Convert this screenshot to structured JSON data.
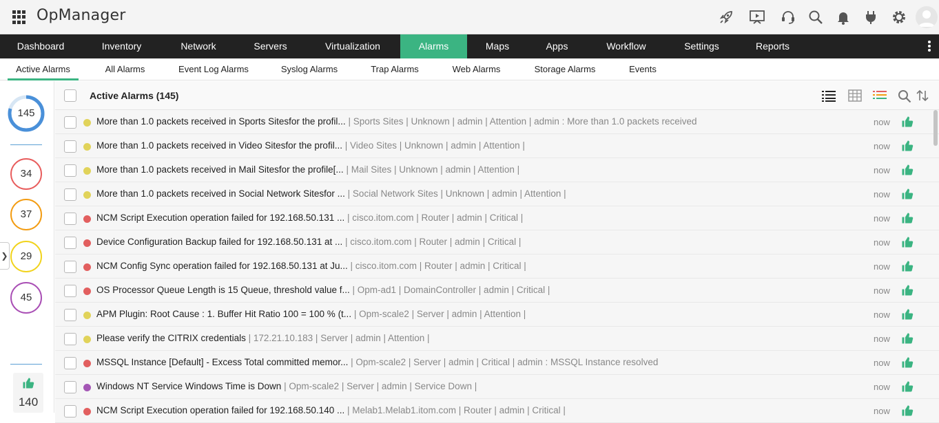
{
  "app": {
    "title": "OpManager"
  },
  "nav": {
    "items": [
      {
        "label": "Dashboard"
      },
      {
        "label": "Inventory"
      },
      {
        "label": "Network"
      },
      {
        "label": "Servers"
      },
      {
        "label": "Virtualization"
      },
      {
        "label": "Alarms"
      },
      {
        "label": "Maps"
      },
      {
        "label": "Apps"
      },
      {
        "label": "Workflow"
      },
      {
        "label": "Settings"
      },
      {
        "label": "Reports"
      }
    ],
    "active": "Alarms"
  },
  "subnav": {
    "items": [
      {
        "label": "Active Alarms"
      },
      {
        "label": "All Alarms"
      },
      {
        "label": "Event Log Alarms"
      },
      {
        "label": "Syslog Alarms"
      },
      {
        "label": "Trap Alarms"
      },
      {
        "label": "Web Alarms"
      },
      {
        "label": "Storage Alarms"
      },
      {
        "label": "Events"
      }
    ],
    "active": "Active Alarms"
  },
  "sidebar": {
    "total": "145",
    "counts": [
      {
        "value": "34",
        "color": "#e85c5c"
      },
      {
        "value": "37",
        "color": "#f39c12"
      },
      {
        "value": "29",
        "color": "#f1d31c"
      },
      {
        "value": "45",
        "color": "#a94fb5"
      }
    ],
    "acknowledged": "140"
  },
  "list": {
    "title": "Active Alarms (145)",
    "rows": [
      {
        "message": "More than 1.0 packets received in Sports Sitesfor the profil...",
        "meta": " | Sports Sites | Unknown | admin | Attention | admin : More than 1.0 packets received",
        "time": "now",
        "severity_color": "#e1d35a"
      },
      {
        "message": "More than 1.0 packets received in Video Sitesfor the profil...",
        "meta": " | Video Sites | Unknown | admin | Attention |",
        "time": "now",
        "severity_color": "#e1d35a"
      },
      {
        "message": "More than 1.0 packets received in Mail Sitesfor the profile[...",
        "meta": " | Mail Sites | Unknown | admin | Attention |",
        "time": "now",
        "severity_color": "#e1d35a"
      },
      {
        "message": "More than 1.0 packets received in Social Network Sitesfor ...",
        "meta": " | Social Network Sites | Unknown | admin | Attention |",
        "time": "now",
        "severity_color": "#e1d35a"
      },
      {
        "message": "NCM Script Execution operation failed for 192.168.50.131 ...",
        "meta": " | cisco.itom.com | Router | admin | Critical |",
        "time": "now",
        "severity_color": "#e25f5f"
      },
      {
        "message": "Device Configuration Backup failed for 192.168.50.131 at ...",
        "meta": " | cisco.itom.com | Router | admin | Critical |",
        "time": "now",
        "severity_color": "#e25f5f"
      },
      {
        "message": "NCM Config Sync operation failed for 192.168.50.131 at Ju...",
        "meta": " | cisco.itom.com | Router | admin | Critical |",
        "time": "now",
        "severity_color": "#e25f5f"
      },
      {
        "message": "OS Processor Queue Length is 15 Queue, threshold value f...",
        "meta": " | Opm-ad1 | DomainController | admin | Critical |",
        "time": "now",
        "severity_color": "#e25f5f"
      },
      {
        "message": "APM Plugin: Root Cause : 1. Buffer Hit Ratio 100 = 100 % (t...",
        "meta": " | Opm-scale2 | Server | admin | Attention |",
        "time": "now",
        "severity_color": "#e1d35a"
      },
      {
        "message": "Please verify the CITRIX credentials",
        "meta": " | 172.21.10.183 | Server | admin | Attention |",
        "time": "now",
        "severity_color": "#e1d35a"
      },
      {
        "message": "MSSQL Instance [Default] - Excess Total committed memor...",
        "meta": " | Opm-scale2 | Server | admin | Critical | admin : MSSQL Instance resolved",
        "time": "now",
        "severity_color": "#e25f5f"
      },
      {
        "message": "Windows NT Service Windows Time is Down",
        "meta": " | Opm-scale2 | Server | admin | Service Down |",
        "time": "now",
        "severity_color": "#a457b5"
      },
      {
        "message": "NCM Script Execution operation failed for 192.168.50.140 ...",
        "meta": " | Melab1.Melab1.itom.com | Router | admin | Critical |",
        "time": "now",
        "severity_color": "#e25f5f"
      }
    ]
  },
  "icons": {
    "top": [
      "rocket-icon",
      "presentation-icon",
      "headset-icon",
      "search-icon",
      "bell-icon",
      "plug-icon",
      "gear-icon",
      "avatar-icon"
    ],
    "list_header": [
      "list-view-icon",
      "grid-view-icon",
      "color-list-icon",
      "search-icon",
      "sort-icon"
    ]
  },
  "colors": {
    "accent": "#3bb482",
    "nav_bg": "#222222",
    "total_ring": "#4a90d9"
  }
}
